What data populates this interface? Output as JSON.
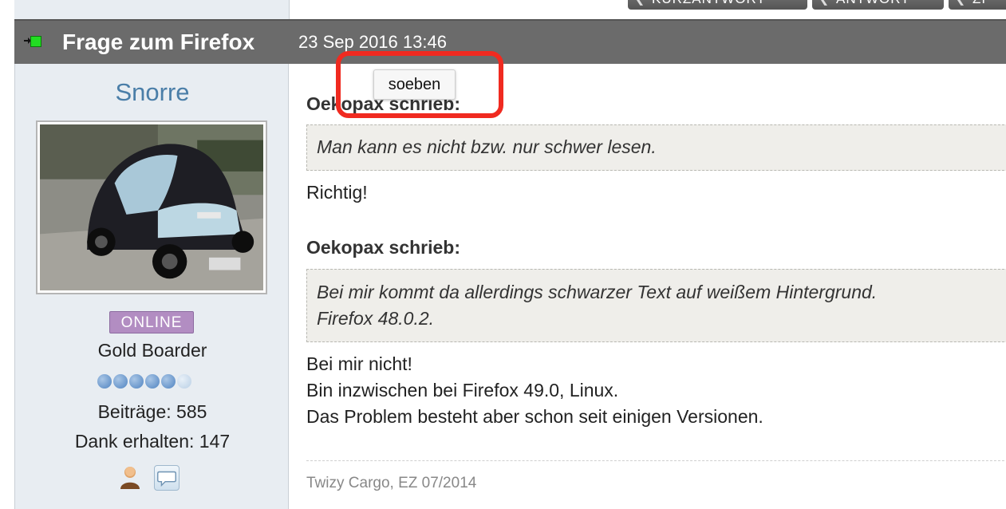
{
  "toolbar": {
    "buttons": [
      "KURZANTWORT",
      "ANTWORT",
      "ZI"
    ]
  },
  "post": {
    "title": "Frage zum Firefox",
    "date": "23 Sep 2016 13:46",
    "tooltip": "soeben"
  },
  "author": {
    "username": "Snorre",
    "online_badge": "ONLINE",
    "rank": "Gold Boarder",
    "rank_level": "5/6",
    "posts": "Beiträge: 585",
    "thanks": "Dank erhalten: 147"
  },
  "body": {
    "quote1_author": "Oekopax schrieb:",
    "quote1_text": "Man kann es nicht bzw. nur schwer lesen.",
    "reply1": "Richtig!",
    "quote2_author": "Oekopax schrieb:",
    "quote2_line1": "Bei mir kommt da allerdings schwarzer Text auf weißem Hintergrund.",
    "quote2_line2": "Firefox 48.0.2.",
    "reply2_line1": "Bei mir nicht!",
    "reply2_line2": "Bin inzwischen bei Firefox 49.0, Linux.",
    "reply2_line3": "Das Problem besteht aber schon seit einigen Versionen."
  },
  "signature": "Twizy Cargo, EZ 07/2014",
  "colors": {
    "header_bg": "#6b6b6b",
    "sidebar_bg": "#e8edf2",
    "username": "#4a7ea8",
    "online_badge": "#b28dc2",
    "highlight": "#f02a20"
  },
  "icons": [
    "status-online-icon",
    "profile-icon",
    "private-message-icon",
    "reply-arrow-icon"
  ]
}
